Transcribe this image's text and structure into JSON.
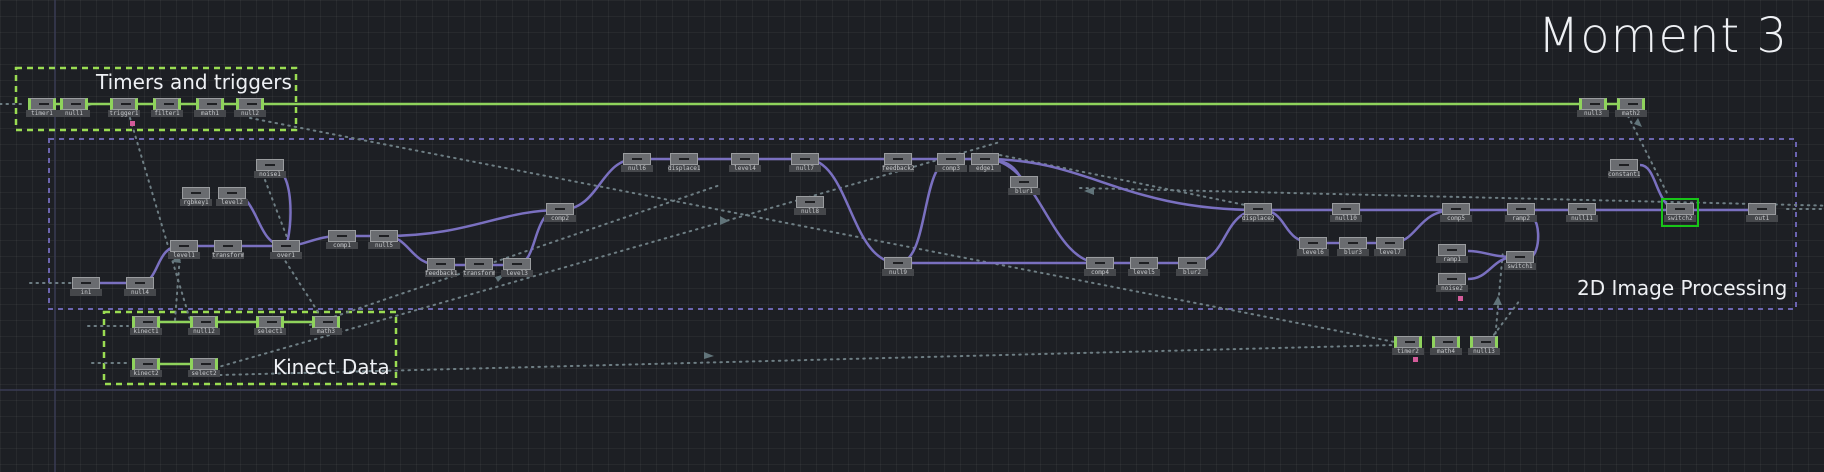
{
  "title": "Moment 3",
  "groups": {
    "timers": "Timers and triggers",
    "image": "2D Image Processing",
    "kinect": "Kinect Data"
  },
  "colors": {
    "background": "#1d1f24",
    "chop_wire": "#8fd35c",
    "top_wire": "#7a70c0",
    "group_timers": "#9adc52",
    "group_image": "#6b64b0",
    "selected": "#18c518",
    "flag": "#d35b9a"
  },
  "operators": {
    "t1": "timer1",
    "t2": "null1",
    "t3": "trigger1",
    "t4": "filter1",
    "t5": "math1",
    "t6": "null2",
    "tr1": "null3",
    "tr2": "math2",
    "a1": "in1",
    "a2": "null4",
    "a3": "level1",
    "a4": "transform2",
    "a5": "rgbkey1",
    "a6": "level2",
    "a7": "noise1",
    "a8": "over1",
    "a9": "comp1",
    "a10": "null5",
    "a11": "feedback1",
    "a12": "transform1",
    "a13": "level3",
    "a14": "comp2",
    "b1": "null6",
    "b2": "displace1",
    "b3": "level4",
    "b4": "null7",
    "b5": "feedback2",
    "b6": "comp3",
    "b7": "edge1",
    "b8": "blur1",
    "b9": "null8",
    "b10": "null9",
    "b11": "comp4",
    "b12": "level5",
    "b13": "blur2",
    "c1": "displace2",
    "c2": "level6",
    "c3": "null10",
    "c4": "blur3",
    "c5": "level7",
    "c6": "comp5",
    "c7": "ramp1",
    "c8": "noise2",
    "c9": "ramp2",
    "c10": "switch1",
    "c11": "constant1",
    "c12": "null11",
    "c13": "switch2",
    "c14": "out1",
    "k1": "kinect1",
    "k2": "null12",
    "k3": "select1",
    "k4": "math3",
    "k5": "kinect2",
    "k6": "select2",
    "m1": "timer2",
    "m2": "math4",
    "m3": "null13"
  }
}
